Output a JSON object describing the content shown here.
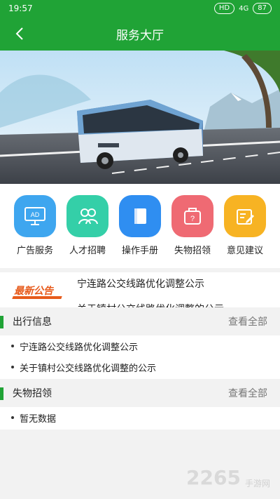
{
  "status_bar": {
    "time": "19:57",
    "hd": "HD",
    "signal": "4G",
    "battery": "87"
  },
  "header": {
    "title": "服务大厅"
  },
  "menu": [
    {
      "label": "广告服务",
      "icon": "ad-icon",
      "color": "#3ea6ef"
    },
    {
      "label": "人才招聘",
      "icon": "people-icon",
      "color": "#34cfa8"
    },
    {
      "label": "操作手册",
      "icon": "book-icon",
      "color": "#2f8ef1"
    },
    {
      "label": "失物招领",
      "icon": "bag-icon",
      "color": "#ef6a73"
    },
    {
      "label": "意见建议",
      "icon": "note-edit-icon",
      "color": "#f7b323"
    }
  ],
  "notice": {
    "logo": "最新公告",
    "lines": [
      "宁连路公交线路优化调整公示",
      "关于镇村公交线路优化调整的公示"
    ]
  },
  "sections": [
    {
      "title": "出行信息",
      "more": "查看全部",
      "items": [
        "宁连路公交线路优化调整公示",
        "关于镇村公交线路优化调整的公示"
      ]
    },
    {
      "title": "失物招领",
      "more": "查看全部",
      "items": [
        "暂无数据"
      ]
    }
  ],
  "watermark": {
    "text": "2265",
    "sub": "手游网"
  },
  "colors": {
    "primary": "#20a336"
  }
}
